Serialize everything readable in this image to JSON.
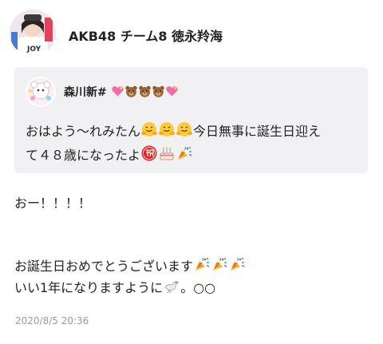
{
  "post": {
    "author": "AKB48 チーム8  徳永羚海",
    "timestamp": "2020/8/5 20:36"
  },
  "quote": {
    "name": "森川新#",
    "line1": "おはよう〜れみたん",
    "line1_after": "今日無事に誕生日迎え",
    "line2": "て４８歳になったよ"
  },
  "reply": {
    "line1": "おー！！！！",
    "line2": "お誕生日おめでとうございます",
    "line3": "いい1年になりますように",
    "line3_after": "。○○"
  },
  "colors": {
    "timestamp": "#9a9a9a",
    "quote_bg": "#f1f1f3"
  }
}
